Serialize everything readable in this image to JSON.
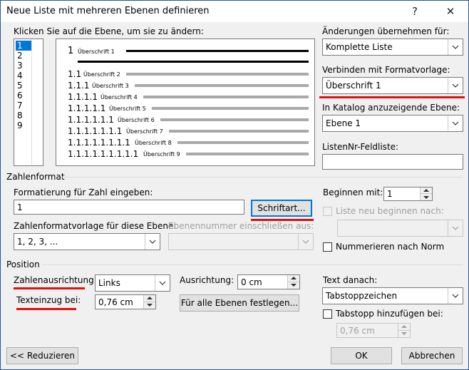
{
  "window": {
    "title": "Neue Liste mit mehreren Ebenen definieren",
    "help_glyph": "?",
    "close_glyph": "✕"
  },
  "levels_section": {
    "label": "Klicken Sie auf die Ebene, um sie zu ändern:",
    "levels": [
      "1",
      "2",
      "3",
      "4",
      "5",
      "6",
      "7",
      "8",
      "9"
    ],
    "selected": "1"
  },
  "preview": {
    "lines": [
      {
        "num": "1",
        "heading": "Überschrift 1"
      },
      {
        "num": "1.1",
        "heading": "Überschrift 2"
      },
      {
        "num": "1.1.1",
        "heading": "Überschrift 3"
      },
      {
        "num": "1.1.1.1",
        "heading": "Überschrift 4"
      },
      {
        "num": "1.1.1.1.1",
        "heading": "Überschrift 5"
      },
      {
        "num": "1.1.1.1.1.1",
        "heading": "Überschrift 6"
      },
      {
        "num": "1.1.1.1.1.1.1",
        "heading": "Überschrift 7"
      },
      {
        "num": "1.1.1.1.1.1.1.1",
        "heading": "Überschrift 8"
      },
      {
        "num": "1.1.1.1.1.1.1.1.1",
        "heading": "Überschrift 9"
      }
    ]
  },
  "right_panel": {
    "apply_label": "Änderungen übernehmen für:",
    "apply_value": "Komplette Liste",
    "link_style_label": "Verbinden mit Formatvorlage:",
    "link_style_value": "Überschrift 1",
    "gallery_label": "In Katalog anzuzeigende Ebene:",
    "gallery_value": "Ebene 1",
    "listnum_label": "ListenNr-Feldliste:",
    "listnum_value": ""
  },
  "number_format": {
    "group_label": "Zahlenformat",
    "format_label": "Formatierung für Zahl eingeben:",
    "format_value": "1",
    "font_button": "Schriftart...",
    "style_label": "Zahlenformatvorlage für diese Ebene:",
    "style_value": "1, 2, 3, ...",
    "include_label": "Ebenennummer einschließen aus:",
    "include_value": "",
    "start_label": "Beginnen mit:",
    "start_value": "1",
    "restart_label": "Liste neu beginnen nach:",
    "restart_value": "",
    "legal_label": "Nummerieren nach Norm"
  },
  "position": {
    "group_label": "Position",
    "alignment_label": "Zahlenausrichtung:",
    "alignment_value": "Links",
    "aligned_at_label": "Ausrichtung:",
    "aligned_at_value": "0 cm",
    "indent_label": "Texteinzug bei:",
    "indent_value": "0,76 cm",
    "set_all_button": "Für alle Ebenen festlegen...",
    "follow_label": "Text danach:",
    "follow_value": "Tabstoppzeichen",
    "tab_add_label": "Tabstopp hinzufügen bei:",
    "tab_add_value": "0,76 cm"
  },
  "footer": {
    "less_button": "<< Reduzieren",
    "ok_button": "OK",
    "cancel_button": "Abbrechen"
  },
  "colors": {
    "accent": "#0078d7",
    "annotation_red": "#e01010",
    "dialog_bg": "#f0f0f0"
  }
}
